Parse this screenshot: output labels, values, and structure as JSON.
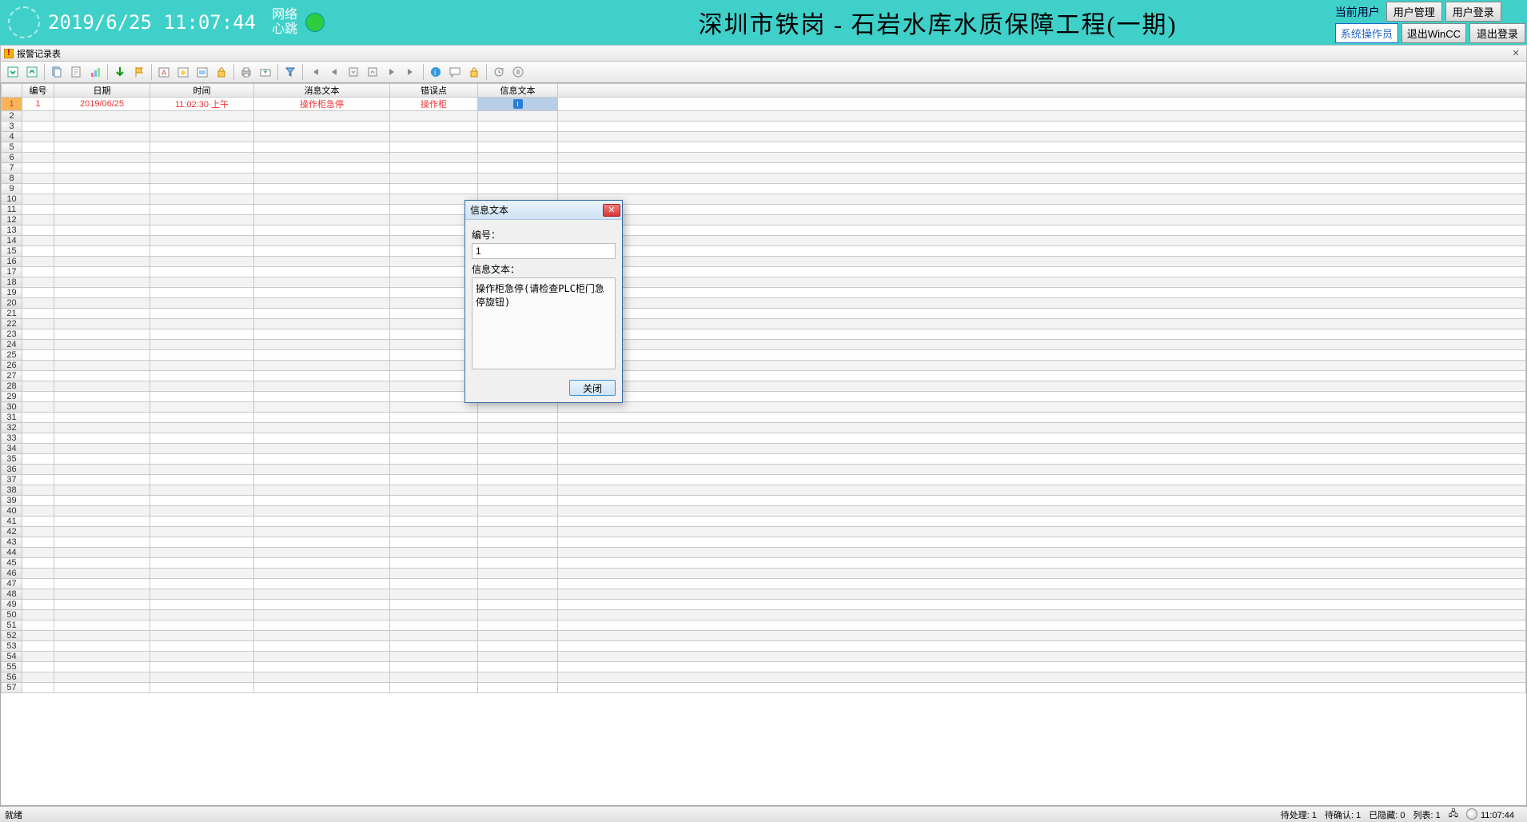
{
  "header": {
    "timestamp": "2019/6/25 11:07:44",
    "heartbeat_l1": "网络",
    "heartbeat_l2": "心跳",
    "title": "深圳市铁岗 - 石岩水库水质保障工程(一期)",
    "cur_user_label": "当前用户",
    "role_badge": "系统操作员",
    "btn_user_mgmt": "用户管理",
    "btn_user_login": "用户登录",
    "btn_exit_wincc": "退出WinCC",
    "btn_logout": "退出登录"
  },
  "window": {
    "title": "报警记录表"
  },
  "grid": {
    "headers": [
      "编号",
      "日期",
      "时间",
      "消息文本",
      "错误点",
      "信息文本"
    ],
    "row1": {
      "id": "1",
      "date": "2019/06/25",
      "time": "11:02:30 上午",
      "msg": "操作柜急停",
      "err": "操作柜"
    },
    "row_count": 57
  },
  "dialog": {
    "title": "信息文本",
    "label_id": "编号：",
    "id_value": "1",
    "label_text": "信息文本：",
    "text_value": "操作柜急停(请检查PLC柜门急停旋钮)",
    "close_btn": "关闭"
  },
  "status": {
    "ready": "就绪",
    "pending": "待处理: 1",
    "ack": "待确认: 1",
    "hidden": "已隐藏: 0",
    "list": "列表: 1",
    "clock": "11:07:44"
  }
}
